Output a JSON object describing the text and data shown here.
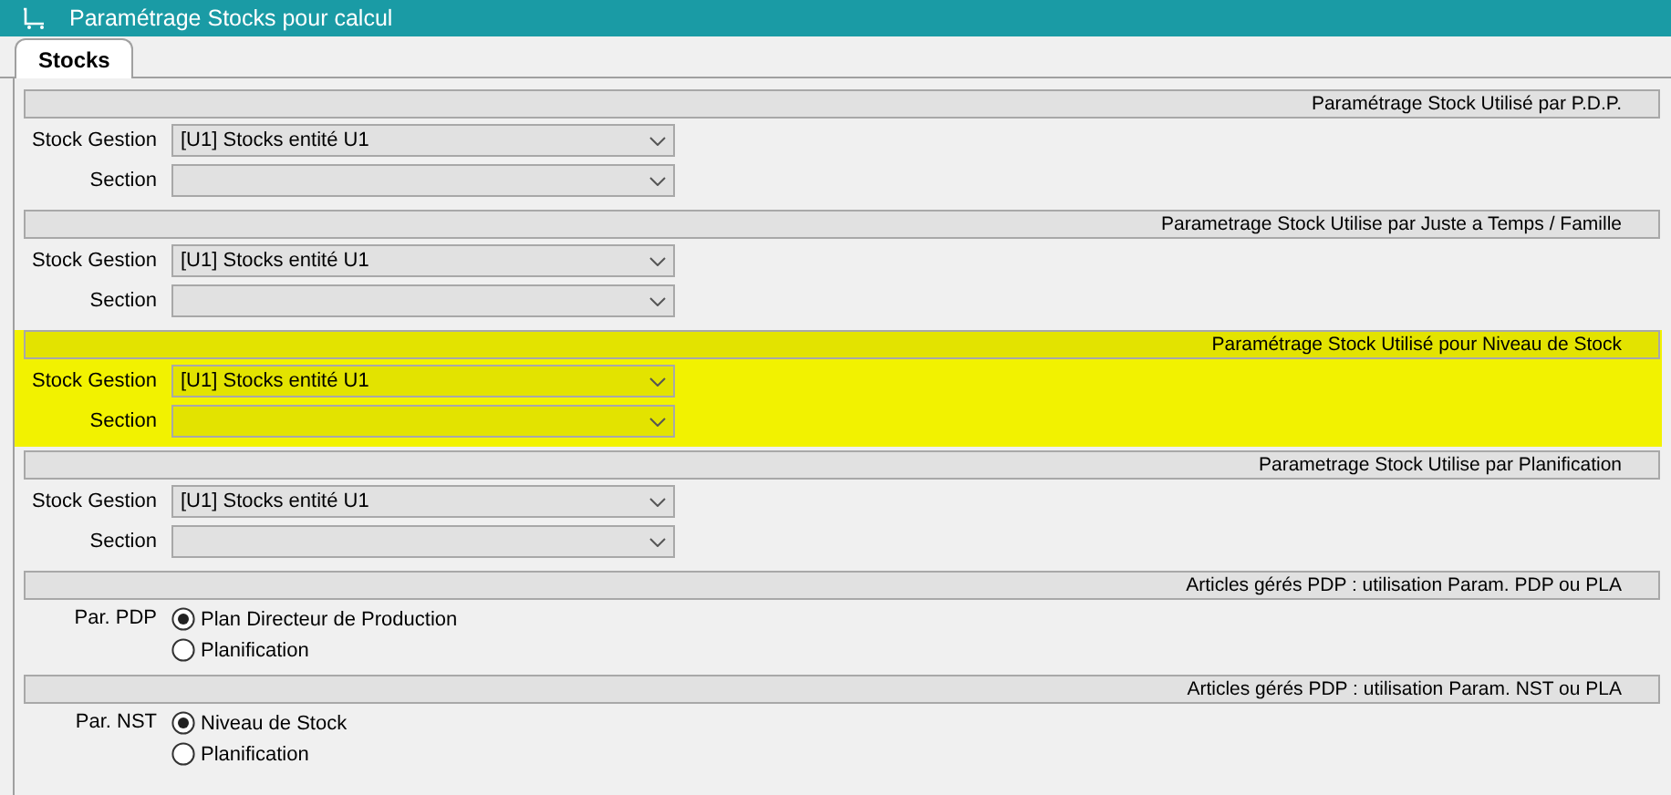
{
  "window": {
    "title": "Paramétrage Stocks pour calcul"
  },
  "tabs": [
    {
      "label": "Stocks",
      "selected": true
    }
  ],
  "sections": [
    {
      "kind": "combos",
      "title": "Paramétrage Stock Utilisé par P.D.P.",
      "highlighted": false,
      "fields": [
        {
          "label": "Stock Gestion",
          "value": "[U1] Stocks entité U1"
        },
        {
          "label": "Section"
        }
      ]
    },
    {
      "kind": "combos",
      "title": "Parametrage Stock Utilise par Juste a Temps / Famille",
      "highlighted": false,
      "fields": [
        {
          "label": "Stock Gestion",
          "value": "[U1] Stocks entité U1"
        },
        {
          "label": "Section"
        }
      ]
    },
    {
      "kind": "combos",
      "title": "Paramétrage Stock Utilisé pour Niveau de Stock",
      "highlighted": true,
      "fields": [
        {
          "label": "Stock Gestion",
          "value": "[U1] Stocks entité U1"
        },
        {
          "label": "Section"
        }
      ]
    },
    {
      "kind": "combos",
      "title": "Parametrage Stock Utilise par Planification",
      "highlighted": false,
      "fields": [
        {
          "label": "Stock Gestion",
          "value": "[U1] Stocks entité U1"
        },
        {
          "label": "Section"
        }
      ]
    },
    {
      "kind": "radios",
      "title": "Articles gérés PDP : utilisation Param. PDP ou PLA",
      "highlighted": false,
      "label": "Par. PDP",
      "options": [
        {
          "label": "Plan Directeur de Production",
          "selected": true
        },
        {
          "label": "Planification",
          "selected": false
        }
      ]
    },
    {
      "kind": "radios",
      "title": "Articles gérés PDP : utilisation Param. NST ou PLA",
      "highlighted": false,
      "label": "Par. NST",
      "options": [
        {
          "label": "Niveau de Stock",
          "selected": true
        },
        {
          "label": "Planification",
          "selected": false
        }
      ]
    }
  ]
}
